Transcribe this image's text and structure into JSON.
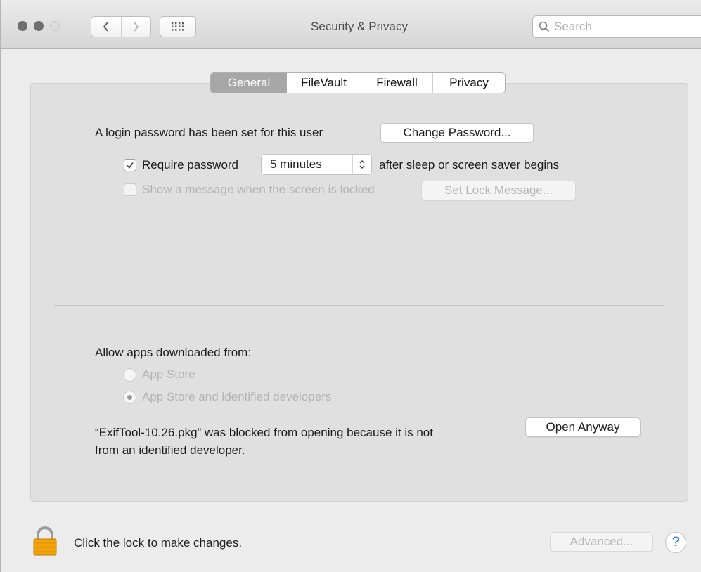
{
  "window": {
    "title": "Security & Privacy",
    "search_placeholder": "Search"
  },
  "tabs": [
    {
      "label": "General",
      "selected": true
    },
    {
      "label": "FileVault",
      "selected": false
    },
    {
      "label": "Firewall",
      "selected": false
    },
    {
      "label": "Privacy",
      "selected": false
    }
  ],
  "general": {
    "login_password_text": "A login password has been set for this user",
    "change_password_label": "Change Password...",
    "require_password_label": "Require password",
    "require_password_checked": true,
    "require_password_delay": "5 minutes",
    "after_sleep_text": "after sleep or screen saver begins",
    "show_message_label": "Show a message when the screen is locked",
    "show_message_checked": false,
    "set_lock_message_label": "Set Lock Message..."
  },
  "downloads": {
    "heading": "Allow apps downloaded from:",
    "options": [
      {
        "label": "App Store",
        "selected": false
      },
      {
        "label": "App Store and identified developers",
        "selected": true
      }
    ],
    "blocked_line1": "“ExifTool-10.26.pkg” was blocked from opening because it is not",
    "blocked_line2": "from an identified developer.",
    "open_anyway_label": "Open Anyway"
  },
  "footer": {
    "lock_text": "Click the lock to make changes.",
    "advanced_label": "Advanced...",
    "help_label": "?"
  },
  "colors": {
    "lock_icon": "#f0a30a",
    "help_accent": "#2a7bf5",
    "selected_tab": "#a7a7a7"
  }
}
